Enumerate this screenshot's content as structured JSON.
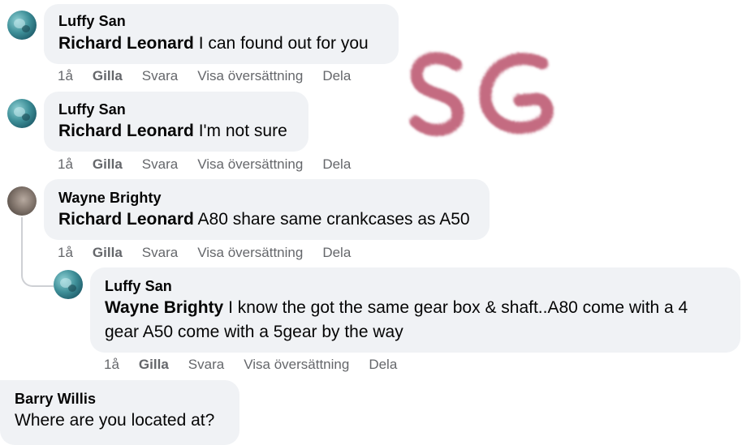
{
  "comments": [
    {
      "author": "Luffy San",
      "mention": "Richard Leonard",
      "text": " I can found out for you",
      "actions": {
        "time": "1å",
        "like": "Gilla",
        "reply": "Svara",
        "translate": "Visa översättning",
        "share": "Dela"
      }
    },
    {
      "author": "Luffy San",
      "mention": "Richard Leonard",
      "text": " I'm not sure",
      "actions": {
        "time": "1å",
        "like": "Gilla",
        "reply": "Svara",
        "translate": "Visa översättning",
        "share": "Dela"
      }
    },
    {
      "author": "Wayne Brighty",
      "mention": "Richard Leonard",
      "text": " A80 share same crankcases as A50",
      "actions": {
        "time": "1å",
        "like": "Gilla",
        "reply": "Svara",
        "translate": "Visa översättning",
        "share": "Dela"
      }
    },
    {
      "author": "Luffy San",
      "mention": "Wayne Brighty",
      "text_line1": " I know the got the same gear box & shaft..A80 come with a 4",
      "text_line2": "gear A50 come with a 5gear by the way",
      "actions": {
        "time": "1å",
        "like": "Gilla",
        "reply": "Svara",
        "translate": "Visa översättning",
        "share": "Dela"
      }
    },
    {
      "author": "Barry Willis",
      "text": "Where are you located at?"
    }
  ],
  "watermark": {
    "text": "SG",
    "color": "#b03a56"
  }
}
